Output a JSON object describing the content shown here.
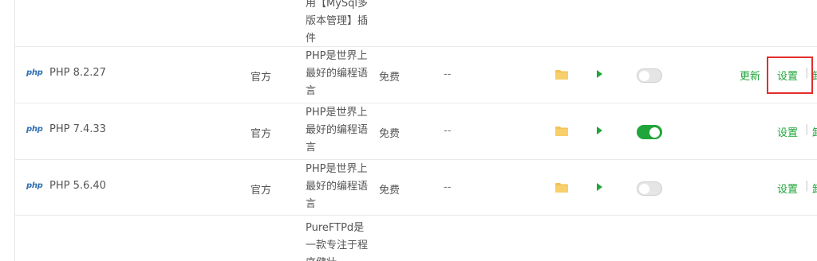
{
  "top_row": {
    "desc": "用【MySql多版本管理】插件"
  },
  "rows": [
    {
      "logo": "php",
      "name": "PHP 8.2.27",
      "developer": "官方",
      "desc": "PHP是世界上最好的编程语言",
      "price": "免费",
      "expire": "--",
      "enabled": false,
      "update_label": "更新",
      "settings_label": "设置",
      "sep": "|"
    },
    {
      "logo": "php",
      "name": "PHP 7.4.33",
      "developer": "官方",
      "desc": "PHP是世界上最好的编程语言",
      "price": "免费",
      "expire": "--",
      "enabled": true,
      "settings_label": "设置",
      "sep": "|"
    },
    {
      "logo": "php",
      "name": "PHP 5.6.40",
      "developer": "官方",
      "desc": "PHP是世界上最好的编程语言",
      "price": "免费",
      "expire": "--",
      "enabled": false,
      "settings_label": "设置",
      "sep": "|"
    },
    {
      "desc": "PureFTPd是一款专注于程序健壮"
    }
  ],
  "colors": {
    "accent_green": "#20a53a",
    "php_blue": "#2f6fb3",
    "folder_yellow": "#f4c256",
    "highlight_red": "#e32d2d"
  }
}
